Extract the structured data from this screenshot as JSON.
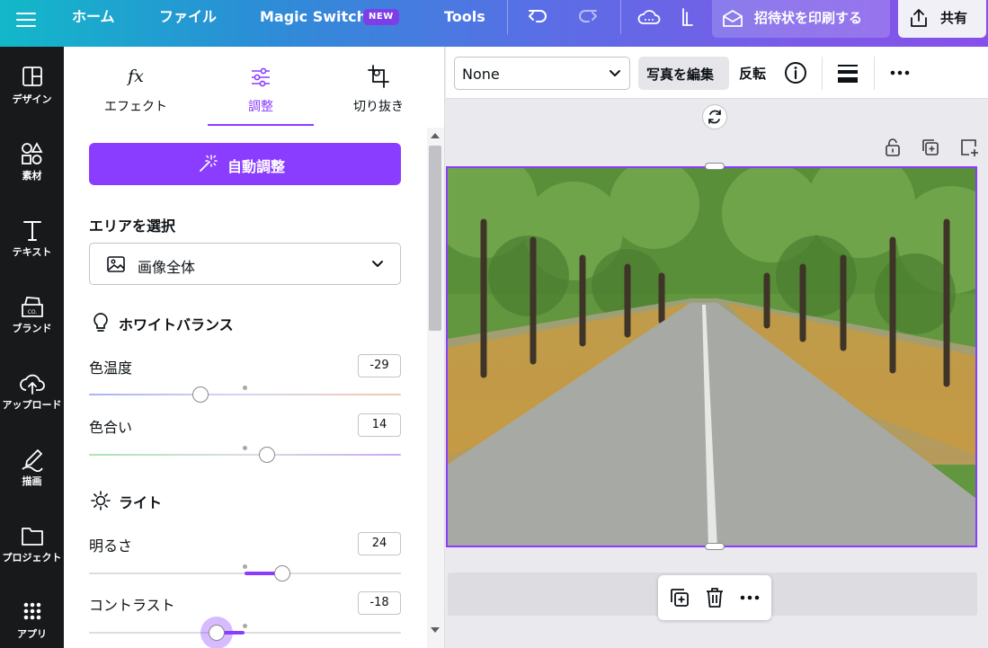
{
  "topbar": {
    "home": "ホーム",
    "file": "ファイル",
    "magic_switch": "Magic Switch",
    "new_badge": "NEW",
    "tools": "Tools",
    "print": "招待状を印刷する",
    "share": "共有"
  },
  "rail": {
    "items": [
      {
        "label": "デザイン",
        "icon": "design-icon"
      },
      {
        "label": "素材",
        "icon": "elements-icon"
      },
      {
        "label": "テキスト",
        "icon": "text-icon"
      },
      {
        "label": "ブランド",
        "icon": "brand-icon"
      },
      {
        "label": "アップロード",
        "icon": "upload-icon"
      },
      {
        "label": "描画",
        "icon": "draw-icon"
      },
      {
        "label": "プロジェクト",
        "icon": "folder-icon"
      },
      {
        "label": "アプリ",
        "icon": "apps-icon"
      }
    ]
  },
  "panel": {
    "tabs": [
      {
        "label": "エフェクト"
      },
      {
        "label": "調整"
      },
      {
        "label": "切り抜き"
      }
    ],
    "active_tab": "調整",
    "auto_adjust": "自動調整",
    "area_title": "エリアを選択",
    "area_value": "画像全体",
    "white_balance": "ホワイトバランス",
    "light": "ライト",
    "controls": {
      "temperature": {
        "label": "色温度",
        "value": "-29"
      },
      "tint": {
        "label": "色合い",
        "value": "14"
      },
      "brightness": {
        "label": "明るさ",
        "value": "24"
      },
      "contrast": {
        "label": "コントラスト",
        "value": "-18"
      }
    }
  },
  "canvas": {
    "filter_value": "None",
    "edit_photo": "写真を編集",
    "flip": "反転"
  },
  "colors": {
    "accent": "#8b3dff",
    "rail_bg": "#18191b"
  }
}
